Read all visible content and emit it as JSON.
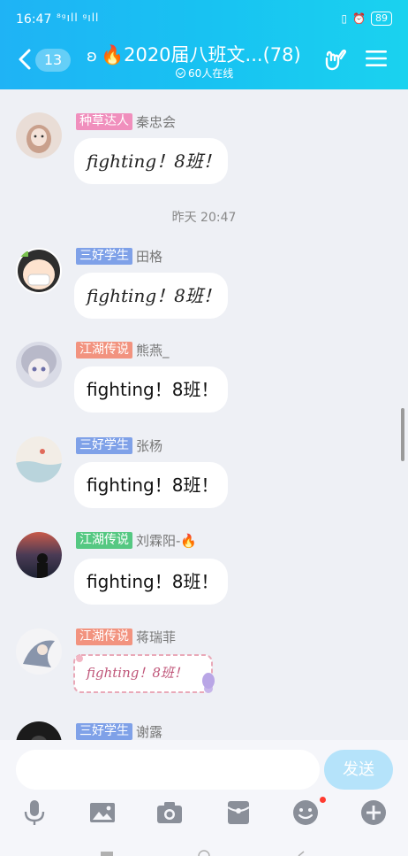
{
  "status_bar": {
    "time": "16:47",
    "signal": "⁸ᵍıll ᵍıll",
    "battery": "89"
  },
  "header": {
    "back_count": "13",
    "title": "🔥2020届八班文...(78)",
    "ear_glyph": "ʚ",
    "online": "60人在线"
  },
  "messages": [
    {
      "tag": "种草达人",
      "tag_color": "pink",
      "nick": "秦忠会",
      "text": "fighting！8班！",
      "style": "cursive"
    },
    {
      "timestamp": "昨天 20:47"
    },
    {
      "tag": "三好学生",
      "tag_color": "blue",
      "nick": "田格",
      "text": "fighting！8班！",
      "style": "cursive"
    },
    {
      "tag": "江湖传说",
      "tag_color": "orange",
      "nick": "熊燕_",
      "text": "fighting！8班！",
      "style": "plain"
    },
    {
      "tag": "三好学生",
      "tag_color": "blue",
      "nick": "张杨",
      "text": "fighting！8班！",
      "style": "plain"
    },
    {
      "tag": "江湖传说",
      "tag_color": "green",
      "nick": "刘霖阳-🔥",
      "text": "fighting！8班！",
      "style": "plain"
    },
    {
      "tag": "江湖传说",
      "tag_color": "orange",
      "nick": "蒋瑞菲",
      "text": "fighting！8班！",
      "style": "sticker"
    },
    {
      "tag": "三好学生",
      "tag_color": "blue",
      "nick": "谢露"
    }
  ],
  "input_bar": {
    "placeholder": "",
    "send_label": "发送"
  },
  "tools": [
    "microphone-icon",
    "image-icon",
    "camera-icon",
    "red-packet-icon",
    "emoji-icon",
    "plus-icon"
  ],
  "colors": {
    "header_start": "#1fb3f5",
    "header_end": "#1ad2ef",
    "send_button": "#b5e3fa",
    "chat_bg": "#eef0f5"
  }
}
